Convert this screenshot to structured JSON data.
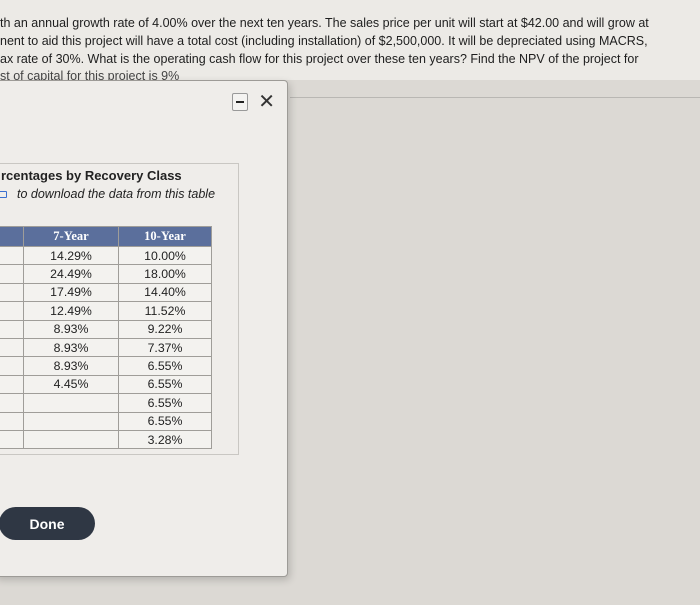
{
  "question": {
    "line1": "th an annual growth rate of 4.00% over the next ten years.  The sales price per unit will start at $42.00 and will grow at",
    "line2": "nent to aid this project will have a total cost (including installation) of $2,500,000.  It will be depreciated using MACRS,",
    "line3": "ax rate of 30%.  What is the operating cash flow for this project over these ten years?  Find the NPV of the project for",
    "line4": "st of capital for this project is 9%"
  },
  "modal": {
    "minimize_icon": "minimize-icon",
    "close_icon": "close-icon",
    "close_glyph": "✕",
    "panel": {
      "title": "rcentages by Recovery Class",
      "download_text": "to download the data from this table",
      "download_icon": "download-icon"
    },
    "table": {
      "headers": [
        "",
        "7-Year",
        "10-Year"
      ],
      "rows": [
        [
          "",
          "14.29%",
          "10.00%"
        ],
        [
          "",
          "24.49%",
          "18.00%"
        ],
        [
          "",
          "17.49%",
          "14.40%"
        ],
        [
          "",
          "12.49%",
          "11.52%"
        ],
        [
          "",
          "8.93%",
          "9.22%"
        ],
        [
          "",
          "8.93%",
          "7.37%"
        ],
        [
          "",
          "8.93%",
          "6.55%"
        ],
        [
          "",
          "4.45%",
          "6.55%"
        ],
        [
          "",
          "",
          "6.55%"
        ],
        [
          "",
          "",
          "6.55%"
        ],
        [
          "",
          "",
          "3.28%"
        ]
      ]
    },
    "done_label": "Done"
  }
}
